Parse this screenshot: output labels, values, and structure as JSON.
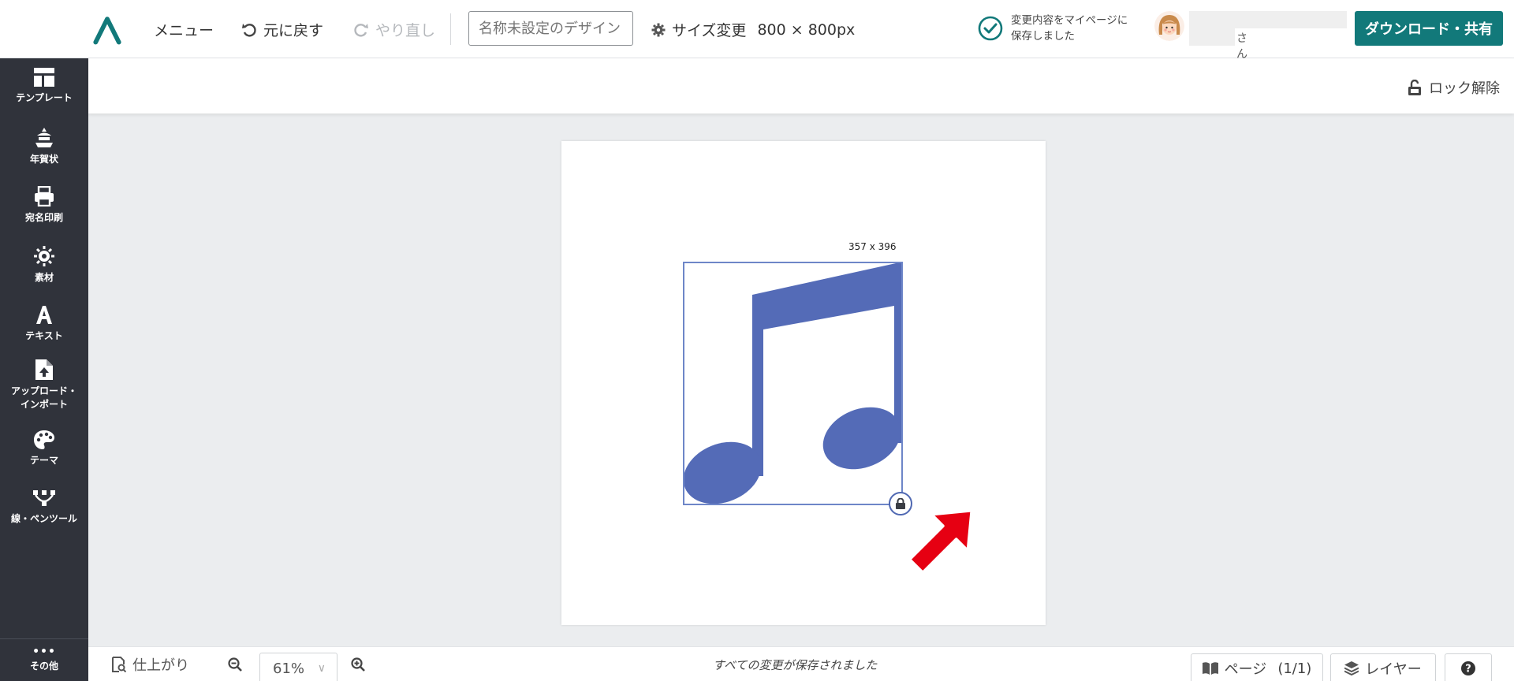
{
  "header": {
    "menu_label": "メニュー",
    "undo_label": "元に戻す",
    "redo_label": "やり直し",
    "design_name_placeholder": "名称未設定のデザイン",
    "resize_label": "サイズ変更",
    "size_value": "800 × 800px",
    "saved_message": "変更内容をマイページに\n保存しました",
    "user_suffix": "さん",
    "download_label": "ダウンロード・共有"
  },
  "sidebar": {
    "items": [
      {
        "label": "テンプレート",
        "icon": "template-icon"
      },
      {
        "label": "年賀状",
        "icon": "new-year-card-icon"
      },
      {
        "label": "宛名印刷",
        "icon": "printer-icon"
      },
      {
        "label": "素材",
        "icon": "materials-icon"
      },
      {
        "label": "テキスト",
        "icon": "text-icon"
      },
      {
        "label": "アップロード・\nインポート",
        "icon": "upload-icon"
      },
      {
        "label": "テーマ",
        "icon": "palette-icon"
      },
      {
        "label": "線・ペンツール",
        "icon": "pen-tool-icon"
      }
    ],
    "more_label": "その他"
  },
  "toolbar": {
    "unlock_label": "ロック解除"
  },
  "canvas": {
    "selection_size": "357 x 396",
    "element": "music-note"
  },
  "footer": {
    "finish_label": "仕上がり",
    "zoom_value": "61%",
    "status": "すべての変更が保存されました",
    "pages_label": "ページ",
    "pages_count": "(1/1)",
    "layers_label": "レイヤー"
  },
  "colors": {
    "accent": "#12797a",
    "sidebar_bg": "#30333b",
    "note": "#546bb7",
    "arrow": "#e60012"
  }
}
